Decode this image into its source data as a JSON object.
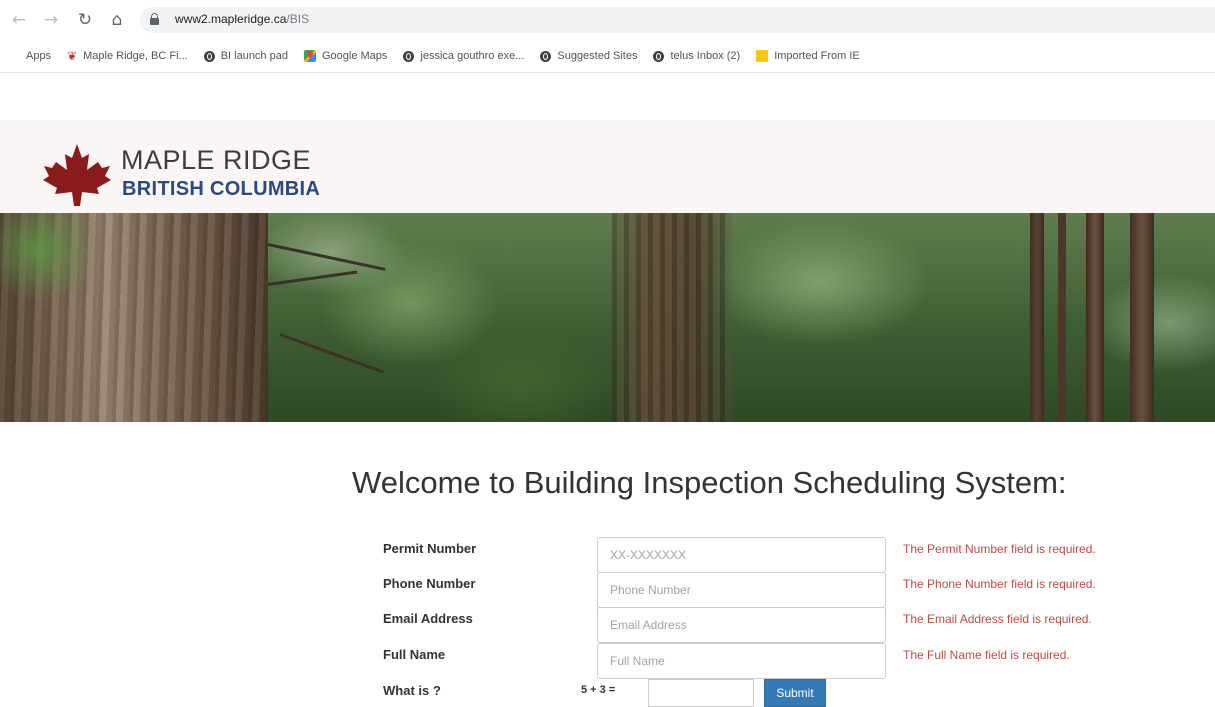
{
  "browser": {
    "url_host": "www2.mapleridge.ca",
    "url_path": "/BIS",
    "icons": [
      "back-icon",
      "forward-icon",
      "reload-icon",
      "home-icon",
      "lock-icon"
    ]
  },
  "bookmarks": [
    {
      "label": "Apps",
      "icon": "apps-grid-icon"
    },
    {
      "label": "Maple Ridge, BC Fi...",
      "icon": "maple-leaf-icon"
    },
    {
      "label": "BI launch pad",
      "icon": "globe-icon"
    },
    {
      "label": "Google Maps",
      "icon": "google-maps-icon"
    },
    {
      "label": "jessica gouthro exe...",
      "icon": "globe-icon"
    },
    {
      "label": "Suggested Sites",
      "icon": "globe-icon"
    },
    {
      "label": "telus Inbox (2)",
      "icon": "globe-icon"
    },
    {
      "label": "Imported From IE",
      "icon": "folder-icon"
    }
  ],
  "site": {
    "brand_line1": "MAPLE RIDGE",
    "brand_line2": "BRITISH COLUMBIA",
    "colors": {
      "leaf": "#8b1a1a",
      "brand_blue": "#2a4a83",
      "error": "#b94a48",
      "button": "#337ab7"
    }
  },
  "form": {
    "title": "Welcome to Building Inspection Scheduling System:",
    "fields": [
      {
        "label": "Permit Number",
        "placeholder": "XX-XXXXXXX",
        "error": "The Permit Number field is required."
      },
      {
        "label": "Phone Number",
        "placeholder": "Phone Number",
        "error": "The Phone Number field is required."
      },
      {
        "label": "Email Address",
        "placeholder": "Email Address",
        "error": "The Email Address field is required."
      },
      {
        "label": "Full Name",
        "placeholder": "Full Name",
        "error": "The Full Name field is required."
      }
    ],
    "captcha_label": "What is ?",
    "captcha_question": "5 + 3 =",
    "submit_label": "Submit"
  }
}
